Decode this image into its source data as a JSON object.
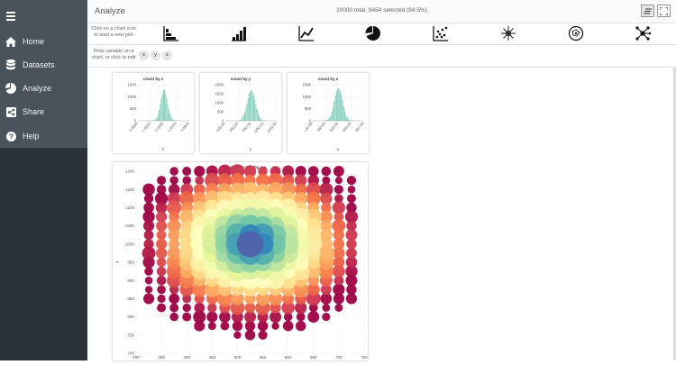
{
  "sidebar": {
    "items": [
      {
        "label": "Home",
        "icon": "home-icon"
      },
      {
        "label": "Datasets",
        "icon": "database-icon"
      },
      {
        "label": "Analyze",
        "icon": "pie-icon"
      },
      {
        "label": "Share",
        "icon": "share-icon"
      },
      {
        "label": "Help",
        "icon": "help-icon"
      }
    ]
  },
  "header": {
    "title": "Analyze",
    "status": "10000 total, 9454 selected (94.5%)"
  },
  "toolbar": {
    "hint_line1": "Click on a chart icon",
    "hint_line2": "to start a new plot",
    "chart_types": [
      "histogram-icon",
      "bar-chart-icon",
      "line-chart-icon",
      "pie-chart-icon",
      "scatter-chart-icon",
      "radial-chart-icon",
      "network-cluster-icon",
      "network-graph-icon"
    ]
  },
  "varbar": {
    "hint_line1": "Drop variable on a",
    "hint_line2": "chart, or click to edit",
    "variables": [
      "x",
      "y",
      "z"
    ]
  },
  "colors": {
    "sidebar_bg": "#2a3339",
    "sidebar_top": "#48535b",
    "histogram_fill": "#7fcdbb"
  },
  "chart_data": [
    {
      "type": "bar",
      "title": "count by z",
      "xlabel": "z",
      "ylabel": "",
      "ylim": [
        0,
        1500
      ],
      "yticks": [
        "0",
        "500",
        "1000",
        "1500"
      ],
      "xticks": [
        "-3.4608",
        "-1.9320",
        "0.4920",
        "1.9320",
        "3.4608"
      ],
      "values": [
        1,
        2,
        3,
        5,
        8,
        15,
        25,
        50,
        90,
        160,
        280,
        450,
        680,
        950,
        1150,
        1280,
        1290,
        1150,
        950,
        700,
        470,
        300,
        170,
        95,
        50,
        25,
        14,
        7,
        4,
        2,
        1
      ]
    },
    {
      "type": "bar",
      "title": "count by y",
      "xlabel": "y",
      "ylabel": "",
      "ylim": [
        0,
        2000
      ],
      "yticks": [
        "0",
        "500",
        "1000",
        "1500",
        "2000"
      ],
      "xticks": [
        "525.00",
        "662.00",
        "950.00",
        "1250.00",
        "1425.00"
      ],
      "values": [
        2,
        4,
        8,
        15,
        30,
        60,
        110,
        200,
        330,
        500,
        720,
        980,
        1250,
        1500,
        1650,
        1700,
        1620,
        1420,
        1170,
        900,
        650,
        430,
        270,
        160,
        90,
        45,
        22,
        10,
        5,
        2
      ]
    },
    {
      "type": "bar",
      "title": "count by x",
      "xlabel": "x",
      "ylabel": "",
      "ylim": [
        0,
        1500
      ],
      "yticks": [
        "0",
        "500",
        "1000",
        "1500"
      ],
      "xticks": [
        "133.00",
        "260.00",
        "500.00",
        "683.00",
        "867.00"
      ],
      "values": [
        2,
        4,
        9,
        18,
        35,
        70,
        130,
        230,
        380,
        580,
        820,
        1060,
        1250,
        1350,
        1360,
        1260,
        1080,
        850,
        610,
        400,
        240,
        140,
        75,
        38,
        18,
        9,
        4,
        2
      ]
    },
    {
      "type": "scatter",
      "title": "avg of zavg of z by x y",
      "xlabel": "",
      "ylabel": "y",
      "xlim": [
        300,
        750
      ],
      "ylim": [
        700,
        1200
      ],
      "xticks": [
        "300",
        "350",
        "400",
        "450",
        "500",
        "550",
        "600",
        "650",
        "700",
        "750"
      ],
      "yticks": [
        "700",
        "750",
        "800",
        "850",
        "900",
        "950",
        "1000",
        "1050",
        "1100",
        "1150",
        "1200"
      ],
      "grid": {
        "x_start": 325,
        "x_step": 25,
        "x_count": 17,
        "y_start": 750,
        "y_step": 25,
        "y_count": 19
      },
      "center": {
        "x": 530,
        "y": 1005
      },
      "radius": 225,
      "note": "bubble color = average z (spectral scale, red high to blue low), bubble size = count"
    }
  ]
}
